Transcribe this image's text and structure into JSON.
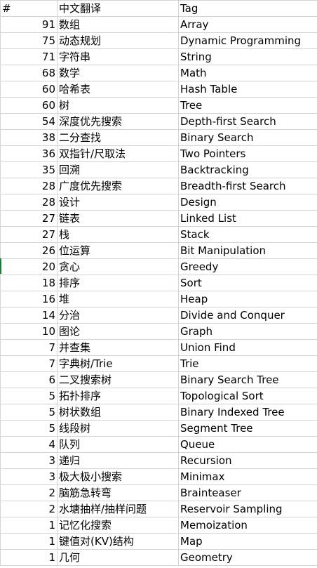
{
  "header": {
    "num": "#",
    "cn": "中文翻译",
    "tag": "Tag"
  },
  "rows": [
    {
      "num": "91",
      "cn": "数组",
      "tag": "Array"
    },
    {
      "num": "75",
      "cn": "动态规划",
      "tag": "Dynamic Programming"
    },
    {
      "num": "71",
      "cn": "字符串",
      "tag": "String"
    },
    {
      "num": "68",
      "cn": "数学",
      "tag": "Math"
    },
    {
      "num": "60",
      "cn": "哈希表",
      "tag": "Hash Table"
    },
    {
      "num": "60",
      "cn": "树",
      "tag": "Tree"
    },
    {
      "num": "54",
      "cn": "深度优先搜索",
      "tag": "Depth-first Search"
    },
    {
      "num": "38",
      "cn": "二分查找",
      "tag": "Binary Search"
    },
    {
      "num": "36",
      "cn": "双指针/尺取法",
      "tag": "Two Pointers"
    },
    {
      "num": "35",
      "cn": "回溯",
      "tag": "Backtracking"
    },
    {
      "num": "28",
      "cn": "广度优先搜索",
      "tag": "Breadth-first Search"
    },
    {
      "num": "28",
      "cn": "设计",
      "tag": "Design"
    },
    {
      "num": "27",
      "cn": "链表",
      "tag": "Linked List"
    },
    {
      "num": "27",
      "cn": "栈",
      "tag": "Stack"
    },
    {
      "num": "26",
      "cn": "位运算",
      "tag": "Bit Manipulation"
    },
    {
      "num": "20",
      "cn": "贪心",
      "tag": "Greedy"
    },
    {
      "num": "18",
      "cn": "排序",
      "tag": "Sort"
    },
    {
      "num": "16",
      "cn": "堆",
      "tag": "Heap"
    },
    {
      "num": "14",
      "cn": "分治",
      "tag": "Divide and Conquer"
    },
    {
      "num": "10",
      "cn": "图论",
      "tag": "Graph"
    },
    {
      "num": "7",
      "cn": "并查集",
      "tag": "Union Find"
    },
    {
      "num": "7",
      "cn": "字典树/Trie",
      "tag": "Trie"
    },
    {
      "num": "6",
      "cn": "二叉搜索树",
      "tag": "Binary Search Tree"
    },
    {
      "num": "5",
      "cn": "拓扑排序",
      "tag": "Topological Sort"
    },
    {
      "num": "5",
      "cn": "树状数组",
      "tag": "Binary Indexed Tree"
    },
    {
      "num": "5",
      "cn": "线段树",
      "tag": "Segment Tree"
    },
    {
      "num": "4",
      "cn": "队列",
      "tag": "Queue"
    },
    {
      "num": "3",
      "cn": "递归",
      "tag": "Recursion"
    },
    {
      "num": "3",
      "cn": "极大极小搜索",
      "tag": "Minimax"
    },
    {
      "num": "2",
      "cn": "脑筋急转弯",
      "tag": "Brainteaser"
    },
    {
      "num": "2",
      "cn": "水塘抽样/抽样问题",
      "tag": "Reservoir Sampling"
    },
    {
      "num": "1",
      "cn": "记忆化搜索",
      "tag": "Memoization"
    },
    {
      "num": "1",
      "cn": "键值对(KV)结构",
      "tag": "Map"
    },
    {
      "num": "1",
      "cn": "几何",
      "tag": "Geometry"
    }
  ],
  "colors": {
    "grid_line": "#d4d4d4",
    "text": "#000000",
    "row_marker": "#1f7a3a"
  }
}
